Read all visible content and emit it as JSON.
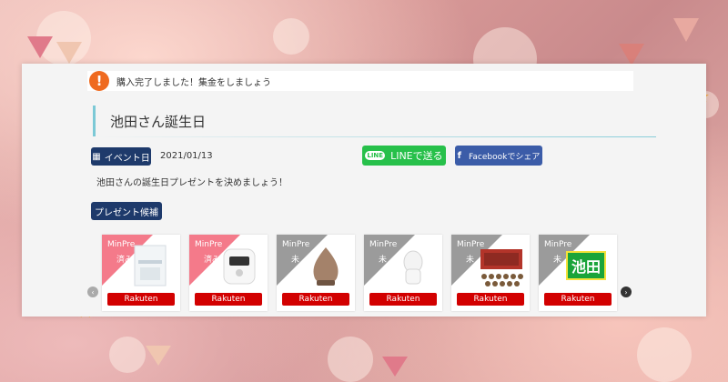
{
  "notice": {
    "icon": "exclamation-icon",
    "text": "購入完了しました！集金をしましょう",
    "icon_glyph": "!"
  },
  "title": "池田さん誕生日",
  "event": {
    "badge_label": "イベント日",
    "date": "2021/01/13"
  },
  "share": {
    "line_label": "LINEで送る",
    "line_icon_text": "LINE",
    "facebook_label": "Facebookでシェア",
    "facebook_icon_text": "f"
  },
  "description": "池田さんの誕生日プレゼントを決めましょう！",
  "present_badge_label": "プレゼント候補",
  "products": [
    {
      "tag": "MinPre",
      "status": "済み",
      "ribbon_color": "#f47a8a",
      "button": "Rakuten",
      "thumb": "product-box-image"
    },
    {
      "tag": "MinPre",
      "status": "済み",
      "ribbon_color": "#f47a8a",
      "button": "Rakuten",
      "thumb": "appliance-image"
    },
    {
      "tag": "MinPre",
      "status": "未",
      "ribbon_color": "#9b9b9b",
      "button": "Rakuten",
      "thumb": "humidifier-image"
    },
    {
      "tag": "MinPre",
      "status": "未",
      "ribbon_color": "#9b9b9b",
      "button": "Rakuten",
      "thumb": "facial-steamer-image"
    },
    {
      "tag": "MinPre",
      "status": "未",
      "ribbon_color": "#9b9b9b",
      "button": "Rakuten",
      "thumb": "food-set-image"
    },
    {
      "tag": "MinPre",
      "status": "未",
      "ribbon_color": "#9b9b9b",
      "button": "Rakuten",
      "thumb": "name-sign-image",
      "thumb_text": "池田"
    }
  ],
  "colors": {
    "accent_navy": "#1e3a6b",
    "line_green": "#27c04a",
    "facebook_blue": "#3b5ca8",
    "rakuten_red": "#d20000",
    "notice_orange": "#ef6a1f"
  },
  "nav": {
    "prev_icon": "chevron-left-icon",
    "next_icon": "chevron-right-icon",
    "prev_glyph": "‹",
    "next_glyph": "›"
  }
}
